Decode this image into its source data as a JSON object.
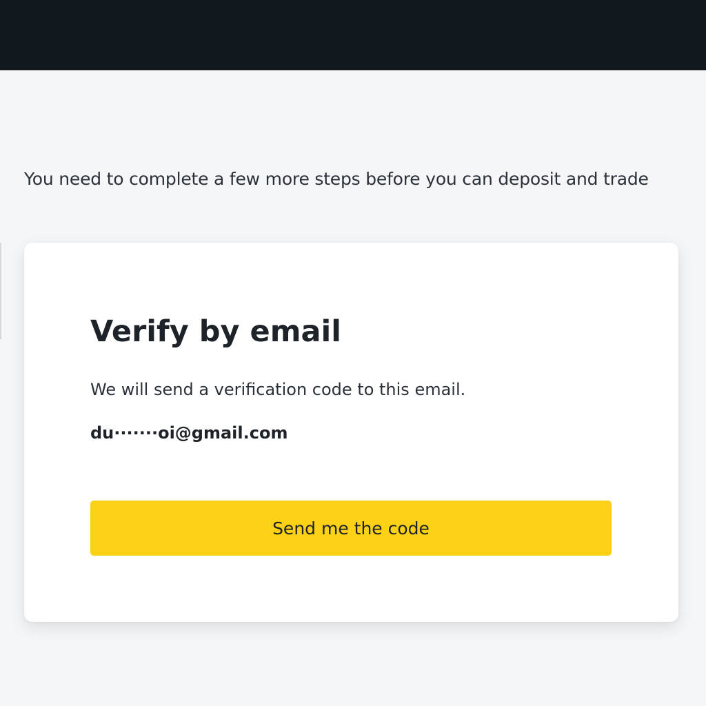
{
  "intro": {
    "text": "You need to complete a few more steps before you can deposit and trade"
  },
  "verify_card": {
    "title": "Verify by email",
    "description": "We will send a verification code to this email.",
    "email": "du·······oi@gmail.com",
    "send_button_label": "Send me the code"
  },
  "colors": {
    "top_bar": "#11181e",
    "page_background": "#f4f6f8",
    "card_background": "#ffffff",
    "accent_button": "#fcd116",
    "text_primary": "#1e2329"
  }
}
